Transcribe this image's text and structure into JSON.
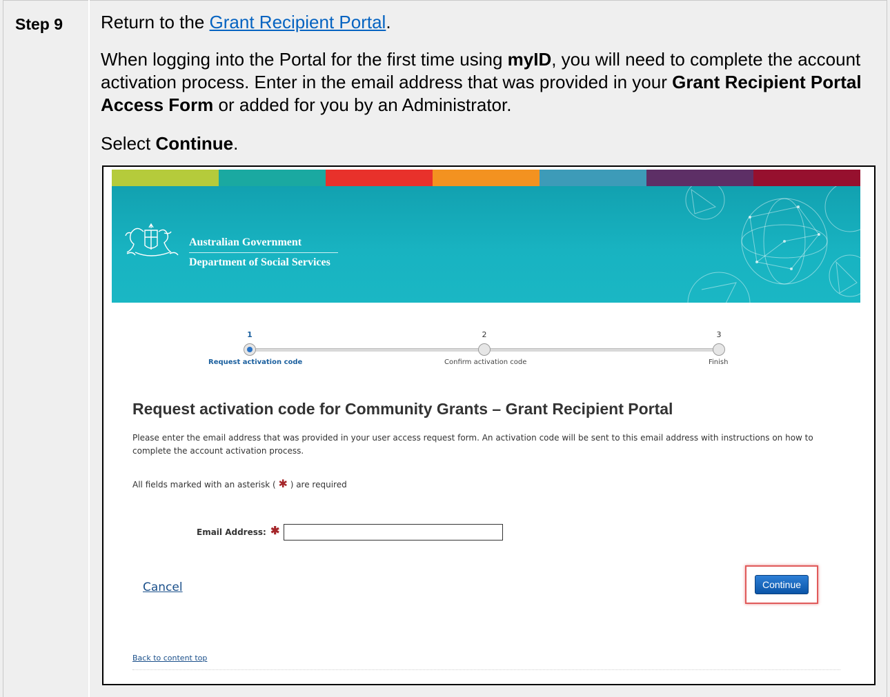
{
  "document": {
    "step_label": "Step 9",
    "line1_prefix": "Return to the ",
    "line1_link": "Grant Recipient Portal",
    "line1_suffix": ".",
    "para_a": "When logging into the Portal for the first time using ",
    "para_bold1": "myID",
    "para_b": ", you will need to complete the account activation process. Enter in the email address that was provided in your ",
    "para_bold2": "Grant Recipient Portal Access Form",
    "para_c": " or added for you by an Administrator.",
    "select_prefix": "Select ",
    "select_bold": "Continue",
    "select_suffix": "."
  },
  "screenshot": {
    "stripe_colors": [
      "#b5cb3b",
      "#1aa9a1",
      "#e8312b",
      "#f39220",
      "#3d9bb8",
      "#5d2f66",
      "#96102e"
    ],
    "gov_line1": "Australian Government",
    "gov_line2": "Department of Social Services",
    "steps": [
      {
        "num": "1",
        "label": "Request activation code",
        "active": true
      },
      {
        "num": "2",
        "label": "Confirm activation code",
        "active": false
      },
      {
        "num": "3",
        "label": "Finish",
        "active": false
      }
    ],
    "title": "Request activation code for Community Grants – Grant Recipient Portal",
    "description": "Please enter the email address that was provided in your user access request form. An activation code will be sent to this email address with instructions on how to complete the account activation process.",
    "required_prefix": "All fields marked with an asterisk ( ",
    "required_star": "✱",
    "required_suffix": " ) are required",
    "email_label": "Email Address:",
    "email_value": "",
    "cancel_label": "Cancel",
    "continue_label": "Continue",
    "back_to_top": "Back to content top"
  }
}
